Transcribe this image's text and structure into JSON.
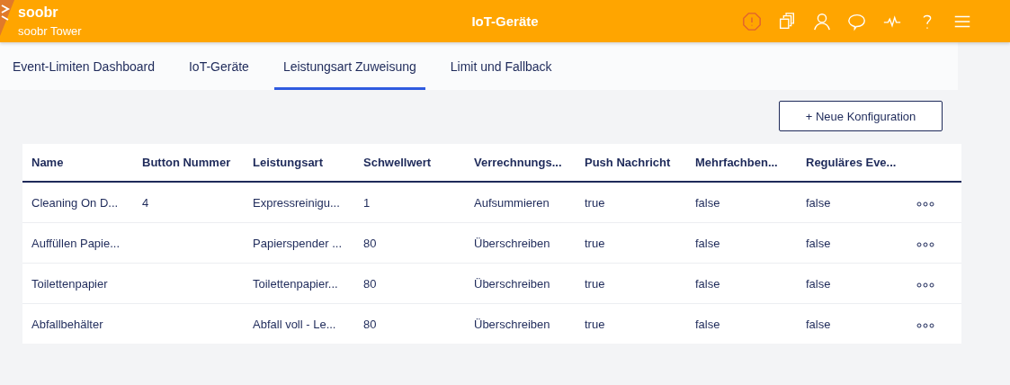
{
  "header": {
    "brand": "soobr",
    "subtitle": "soobr Tower",
    "title": "IoT-Geräte"
  },
  "tabs": [
    {
      "label": "Event-Limiten Dashboard",
      "selected": false
    },
    {
      "label": "IoT-Geräte",
      "selected": false
    },
    {
      "label": "Leistungsart Zuweisung",
      "selected": true
    },
    {
      "label": "Limit und Fallback",
      "selected": false
    }
  ],
  "new_button": "+ Neue Konfiguration",
  "table": {
    "columns": [
      "Name",
      "Button Nummer",
      "Leistungsart",
      "Schwellwert",
      "Verrechnungs...",
      "Push Nachricht",
      "Mehrfachben...",
      "Reguläres Eve..."
    ],
    "rows": [
      [
        "Cleaning On D...",
        "4",
        "Expressreinigu...",
        "1",
        "Aufsummieren",
        "true",
        "false",
        "false"
      ],
      [
        "Auffüllen Papie...",
        "",
        "Papierspender ...",
        "80",
        "Überschreiben",
        "true",
        "false",
        "false"
      ],
      [
        "Toilettenpapier",
        "",
        "Toilettenpapier...",
        "80",
        "Überschreiben",
        "true",
        "false",
        "false"
      ],
      [
        "Abfallbehälter",
        "",
        "Abfall voll - Le...",
        "80",
        "Überschreiben",
        "true",
        "false",
        "false"
      ]
    ]
  }
}
